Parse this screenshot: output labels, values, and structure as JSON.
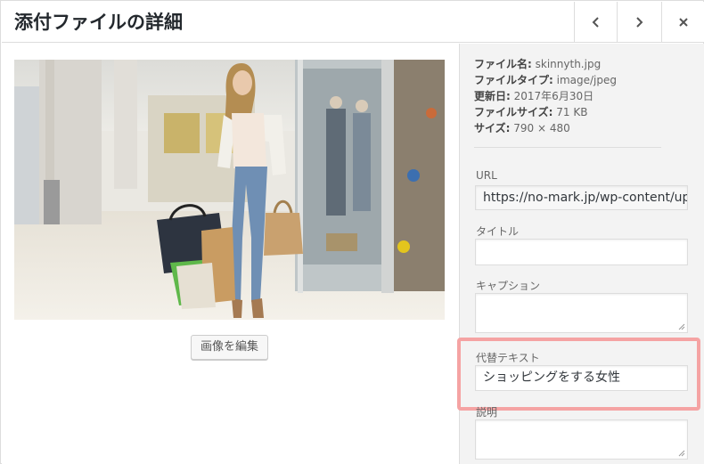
{
  "header": {
    "title": "添付ファイルの詳細"
  },
  "details": {
    "filename_label": "ファイル名:",
    "filename": "skinnyth.jpg",
    "filetype_label": "ファイルタイプ:",
    "filetype": "image/jpeg",
    "uploaded_label": "更新日:",
    "uploaded": "2017年6月30日",
    "filesize_label": "ファイルサイズ:",
    "filesize": "71 KB",
    "dimensions_label": "サイズ:",
    "dimensions": "790 × 480"
  },
  "media": {
    "edit_button": "画像を編集"
  },
  "fields": {
    "url_label": "URL",
    "url_value": "https://no-mark.jp/wp-content/upl",
    "title_label": "タイトル",
    "title_value": "",
    "caption_label": "キャプション",
    "caption_value": "",
    "alt_label": "代替テキスト",
    "alt_value": "ショッピングをする女性",
    "description_label": "説明",
    "description_value": ""
  },
  "icons": [
    "chevron-left-icon",
    "chevron-right-icon",
    "close-icon"
  ],
  "colors": {
    "highlight": "#f5a3a3",
    "sidebar_bg": "#f3f3f3",
    "border": "#dddddd"
  }
}
